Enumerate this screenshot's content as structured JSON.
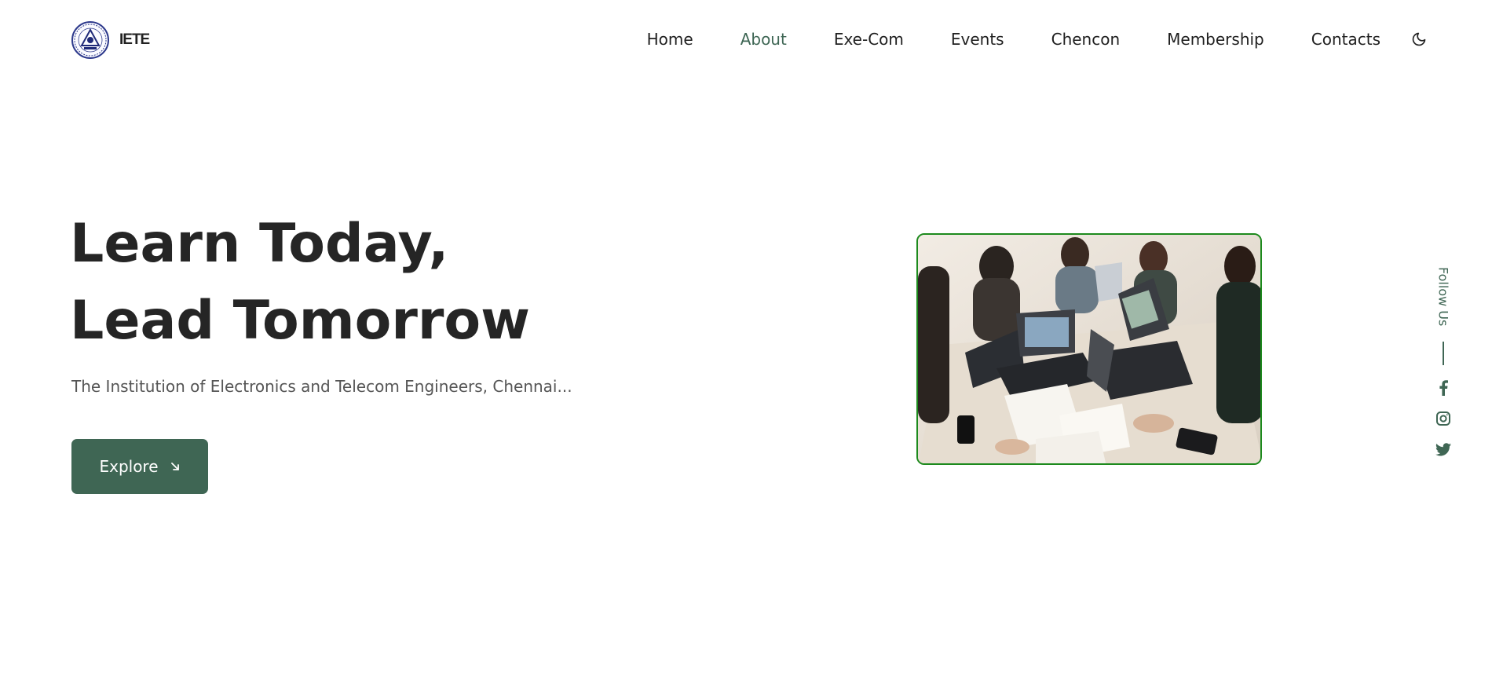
{
  "brand": {
    "name": "IETE",
    "logo_icon": "iete-emblem-logo"
  },
  "nav": {
    "items": [
      {
        "label": "Home",
        "active": false
      },
      {
        "label": "About",
        "active": true
      },
      {
        "label": "Exe-Com",
        "active": false
      },
      {
        "label": "Events",
        "active": false
      },
      {
        "label": "Chencon",
        "active": false
      },
      {
        "label": "Membership",
        "active": false
      },
      {
        "label": "Contacts",
        "active": false
      }
    ],
    "theme_toggle_icon": "moon-icon"
  },
  "hero": {
    "title_line1": "Learn Today,",
    "title_line2": "Lead Tomorrow",
    "subtitle": "The Institution of Electronics and Telecom Engineers, Chennai...",
    "cta_label": "Explore",
    "cta_icon": "arrow-down-right-icon",
    "image_alt": "People collaborating around a table with laptops"
  },
  "social": {
    "label": "Follow Us",
    "links": [
      {
        "name": "facebook",
        "icon": "facebook-icon"
      },
      {
        "name": "instagram",
        "icon": "instagram-icon"
      },
      {
        "name": "twitter",
        "icon": "twitter-icon"
      }
    ]
  },
  "colors": {
    "accent": "#3f6654",
    "photo_border": "#1d8a1d",
    "text_dark": "#252525",
    "text_muted": "#555555"
  }
}
